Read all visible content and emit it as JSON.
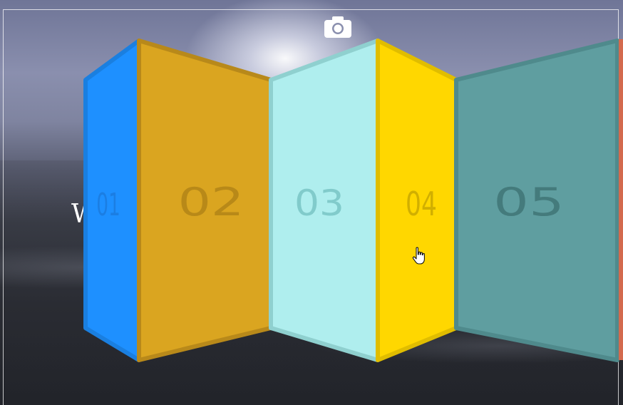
{
  "scene": {
    "background_text": "W",
    "camera_icon": "camera-icon",
    "cursor_icon": "hand-pointer-icon"
  },
  "panels": [
    {
      "label": "01",
      "color": "#1e90ff",
      "border": "#1a7fe0"
    },
    {
      "label": "02",
      "color": "#daa520",
      "border": "#b8891a"
    },
    {
      "label": "03",
      "color": "#afeeee",
      "border": "#8fd0cf"
    },
    {
      "label": "04",
      "color": "#ffd700",
      "border": "#e0bd00"
    },
    {
      "label": "05",
      "color": "#5f9ea0",
      "border": "#4f8a8c"
    }
  ]
}
